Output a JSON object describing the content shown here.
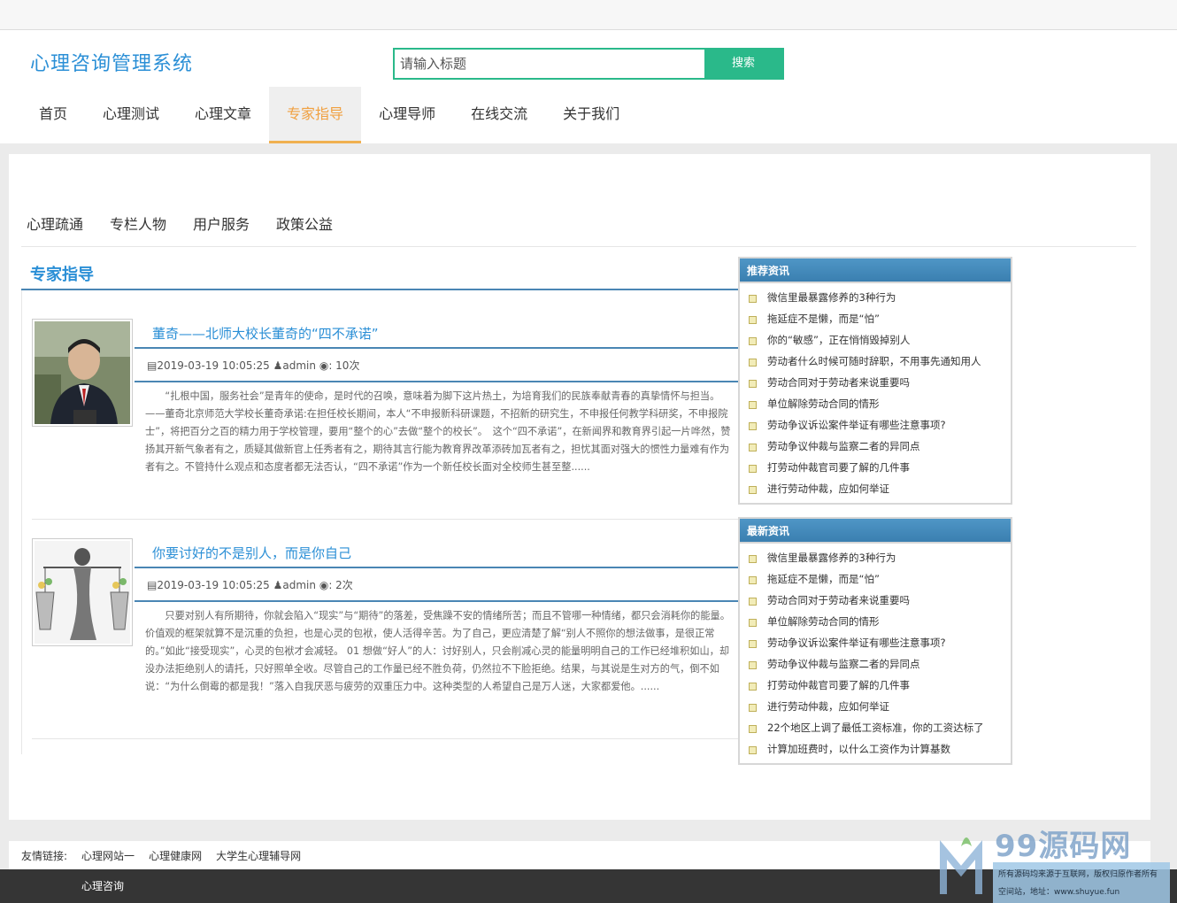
{
  "header": {
    "logo": "心理咨询管理系统",
    "search_placeholder": "请输入标题",
    "search_button": "搜索"
  },
  "nav": [
    "首页",
    "心理测试",
    "心理文章",
    "专家指导",
    "心理导师",
    "在线交流",
    "关于我们"
  ],
  "nav_active": "专家指导",
  "subnav": [
    "心理疏通",
    "专栏人物",
    "用户服务",
    "政策公益"
  ],
  "section_title": "专家指导",
  "articles": [
    {
      "title": "董奇——北师大校长董奇的“四不承诺”",
      "date": "2019-03-19 10:05:25",
      "author": "admin",
      "views": "10次",
      "body": "“扎根中国，服务社会”是青年的使命，是时代的召唤，意味着为脚下这片热土，为培育我们的民族奉献青春的真挚情怀与担当。——董奇北京师范大学校长董奇承诺:在担任校长期间，本人“不申报新科研课题，不招新的研究生，不申报任何教学科研奖，不申报院士”，将把百分之百的精力用于学校管理，要用“整个的心”去做“整个的校长”。　这个“四不承诺”，在新闻界和教育界引起一片哗然，赞扬其开新气象者有之，质疑其做新官上任秀者有之，期待其言行能为教育界改革添砖加瓦者有之，担忧其面对强大的惯性力量难有作为者有之。不管持什么观点和态度者都无法否认，“四不承诺”作为一个新任校长面对全校师生甚至整......"
    },
    {
      "title": "你要讨好的不是别人，而是你自己",
      "date": "2019-03-19 10:05:25",
      "author": "admin",
      "views": "2次",
      "body": "只要对别人有所期待，你就会陷入“现实”与“期待”的落差，受焦躁不安的情绪所苦；而且不管哪一种情绪，都只会消耗你的能量。价值观的框架就算不是沉重的负担，也是心灵的包袱，使人活得辛苦。为了自己，更应清楚了解“别人不照你的想法做事，是很正常的。”如此“接受现实”，心灵的包袱才会减轻。 01 想做“好人”的人：讨好别人，只会削减心灵的能量明明自己的工作已经堆积如山，却没办法拒绝别人的请托，只好照单全收。尽管自己的工作量已经不胜负荷，仍然拉不下脸拒绝。结果，与其说是生对方的气，倒不如说：“为什么倒霉的都是我！”落入自我厌恶与疲劳的双重压力中。这种类型的人希望自己是万人迷，大家都爱他。......"
    }
  ],
  "panels": {
    "recommended": {
      "title": "推荐资讯",
      "items": [
        "微信里最暴露修养的3种行为",
        "拖延症不是懒，而是“怕”",
        "你的“敏感”，正在悄悄毁掉别人",
        "劳动者什么时候可随时辞职，不用事先通知用人",
        "劳动合同对于劳动者来说重要吗",
        "单位解除劳动合同的情形",
        "劳动争议诉讼案件举证有哪些注意事项?",
        "劳动争议仲裁与监察二者的异同点",
        "打劳动仲裁官司要了解的几件事",
        "进行劳动仲裁，应如何举证"
      ]
    },
    "latest": {
      "title": "最新资讯",
      "items": [
        "微信里最暴露修养的3种行为",
        "拖延症不是懒，而是“怕”",
        "劳动合同对于劳动者来说重要吗",
        "单位解除劳动合同的情形",
        "劳动争议诉讼案件举证有哪些注意事项?",
        "劳动争议仲裁与监察二者的异同点",
        "打劳动仲裁官司要了解的几件事",
        "进行劳动仲裁，应如何举证",
        "22个地区上调了最低工资标准，你的工资达标了",
        "计算加班费时，以什么工资作为计算基数"
      ]
    }
  },
  "links": {
    "label": "友情链接:",
    "items": [
      "心理网站一",
      "心理健康网",
      "大学生心理辅导网"
    ]
  },
  "footer": "心理咨询",
  "watermark": {
    "logo": "99源码网",
    "line1": "所有源码均来源于互联网，版权归原作者所有",
    "line2": "空间站，地址：www.shuyue.fun"
  },
  "colors": {
    "brand": "#2b8fd6",
    "search_accent": "#2ab98a",
    "nav_active": "#f0a040",
    "panel_head": "#3a7fb0",
    "footer_bg": "#353535"
  }
}
